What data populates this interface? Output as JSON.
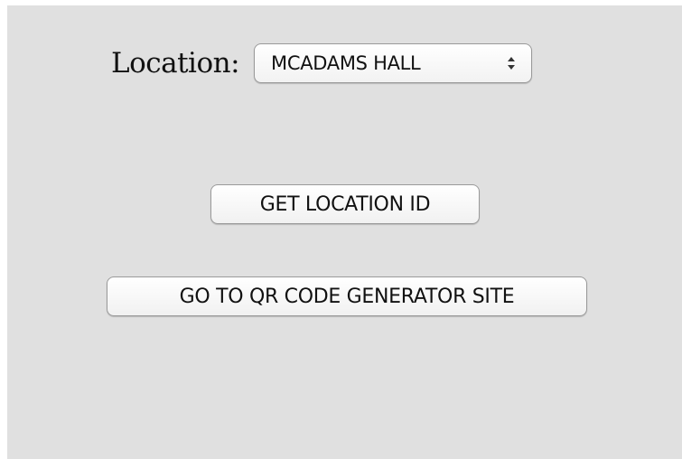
{
  "location": {
    "label": "Location:",
    "selected": "MCADAMS HALL"
  },
  "buttons": {
    "get_location_id": "GET LOCATION ID",
    "qr_generator": "GO TO QR CODE GENERATOR SITE"
  },
  "icons": {
    "select_arrows": "up-down-chevron-icon"
  },
  "colors": {
    "panel_background": "#e0e0e0",
    "control_border": "#9a9a9a",
    "text": "#111111"
  }
}
